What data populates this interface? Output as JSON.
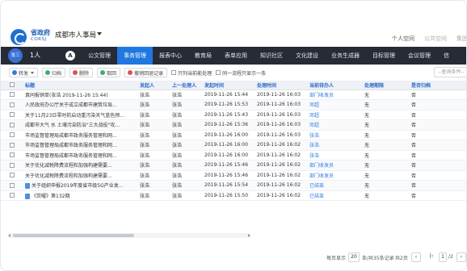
{
  "header": {
    "brand_cn": "省政府",
    "brand_en": "CORSJ",
    "org_name": "成都市人事局",
    "top_links": [
      "个人空间",
      "公共空间",
      "集团"
    ]
  },
  "nav": {
    "avatar_text": "张三",
    "count": "1人",
    "a_label": "A",
    "items": [
      "公文管理",
      "事务管理",
      "报表中心",
      "教育局",
      "表单应用",
      "知识社区",
      "文化建设",
      "业务生成器",
      "目标管理",
      "会议管理",
      "信"
    ],
    "active_index": 1
  },
  "toolbar": {
    "forward": "转发",
    "archive": "归档",
    "delete": "删除",
    "withdraw": "取回",
    "revoke": "撤销回退记录",
    "check1": "只列当前能处理",
    "check2": "同一流程只显示一条",
    "search_placeholder": "--查询条件--"
  },
  "table": {
    "headers": [
      "标题",
      "发起人",
      "上一处理人",
      "发起时间",
      "处理时间",
      "当前待办人",
      "处理期限",
      "是否归档"
    ],
    "rows": [
      [
        "袁同报销单(张浩 2019-11-26 15:44)",
        "张浩",
        "张浩",
        "2019-11-26 15:44",
        "2019-11-26 16:03",
        "部门收发员",
        "无",
        "否"
      ],
      [
        "人民政府办公厅关于成立成都市建筑垃圾...",
        "张浩",
        "张浩",
        "2019-11-26 15:53",
        "2019-11-26 16:03",
        "邓超",
        "无",
        "否"
      ],
      [
        "关于11月23日零时前启动重污染天气蓝色预...",
        "张浩",
        "张浩",
        "2019-11-26 15:43",
        "2019-11-26 16:03",
        "邓超",
        "无",
        "否"
      ],
      [
        "成都市大气 水 土壤污染防治\"三大战役\"攻...",
        "张浩",
        "张浩",
        "2019-11-26 15:36",
        "2019-11-26 16:03",
        "邓超",
        "无",
        "否"
      ],
      [
        "市场监督管理局成都市政务服务管理和网...",
        "张浩",
        "张浩",
        "2019-11-26 16:00",
        "2019-11-26 16:03",
        "张浩",
        "无",
        "否"
      ],
      [
        "市场监督管理局成都市政务服务管理和网...",
        "张浩",
        "张浩",
        "2019-11-26 16:00",
        "2019-11-26 16:02",
        "张浩",
        "无",
        "否"
      ],
      [
        "市场监督管理局成都市政务服务管理和网...",
        "张浩",
        "张浩",
        "2019-11-26 16:00",
        "2019-11-26 16:02",
        "张浩",
        "无",
        "否"
      ],
      [
        "关于优化减税降费流程和加强构建需要...",
        "张浩",
        "张浩",
        "2019-11-26 15:46",
        "2019-11-26 16:02",
        "部门收发员",
        "无",
        "否"
      ],
      [
        "关于优化减税降费流程和加强构建需要...",
        "张浩",
        "张浩",
        "2019-11-26 15:46",
        "2019-11-26 16:02",
        "部门收发员",
        "无",
        "否"
      ],
      [
        "关于组织申报2019年度省市级5G产业发...",
        "张浩",
        "张浩",
        "2019-11-26 15:54",
        "2019-11-26 16:02",
        "已结束",
        "无",
        "否"
      ],
      [
        "《荧曜》第132期",
        "张浩",
        "张浩",
        "2019-11-26 15:50",
        "2019-11-26 16:02",
        "已结束",
        "无",
        "否"
      ]
    ],
    "doc_icon_rows": [
      9,
      10
    ]
  },
  "pager": {
    "per_page_label": "每页显示",
    "per_page": "20",
    "total_label": "条/共35条记录",
    "pages_label": "共2页",
    "current_page": "1",
    "last_label": "/2"
  }
}
